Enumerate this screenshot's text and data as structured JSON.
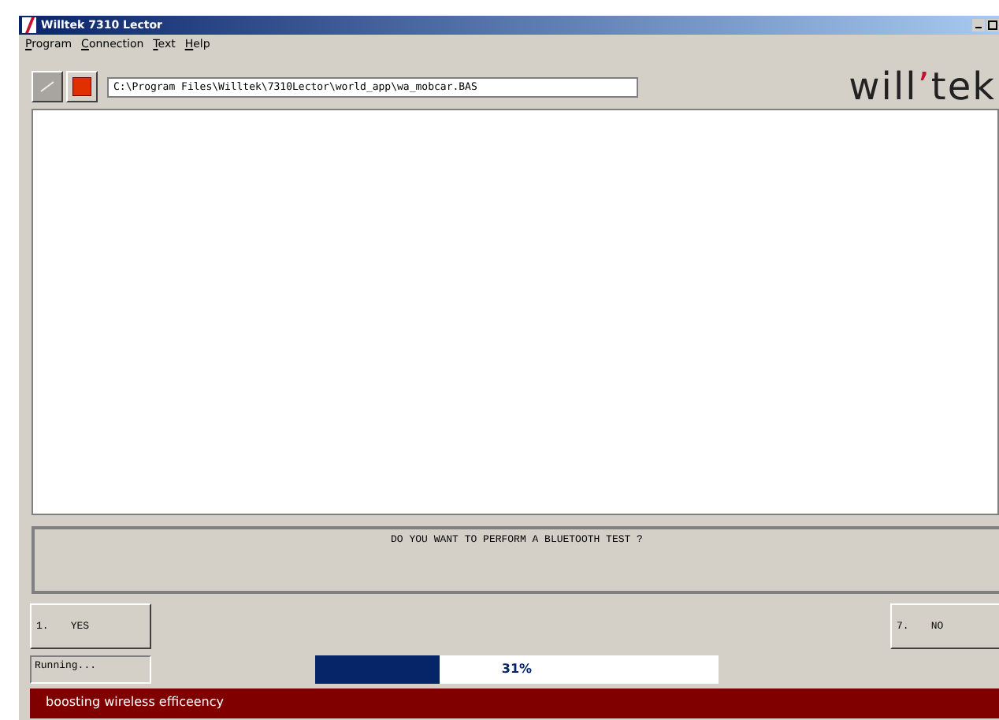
{
  "window": {
    "title": "Willtek 7310 Lector"
  },
  "menu": [
    {
      "label": "Program"
    },
    {
      "label": "Connection"
    },
    {
      "label": "Text"
    },
    {
      "label": "Help"
    }
  ],
  "toolbar": {
    "edit_disabled": true,
    "path": "C:\\Program Files\\Willtek\\7310Lector\\world_app\\wa_mobcar.BAS"
  },
  "logo": {
    "before": "will",
    "mark": "’",
    "after": "tek"
  },
  "prompt": "DO YOU WANT TO PERFORM A BLUETOOTH TEST ?",
  "softkeys": [
    {
      "number": "1.",
      "label": "YES"
    },
    {
      "number": "7.",
      "label": "NO"
    }
  ],
  "status": "Running...",
  "progress": {
    "level": 0.31,
    "label": "31%"
  },
  "banner": "boosting wireless efficeency"
}
